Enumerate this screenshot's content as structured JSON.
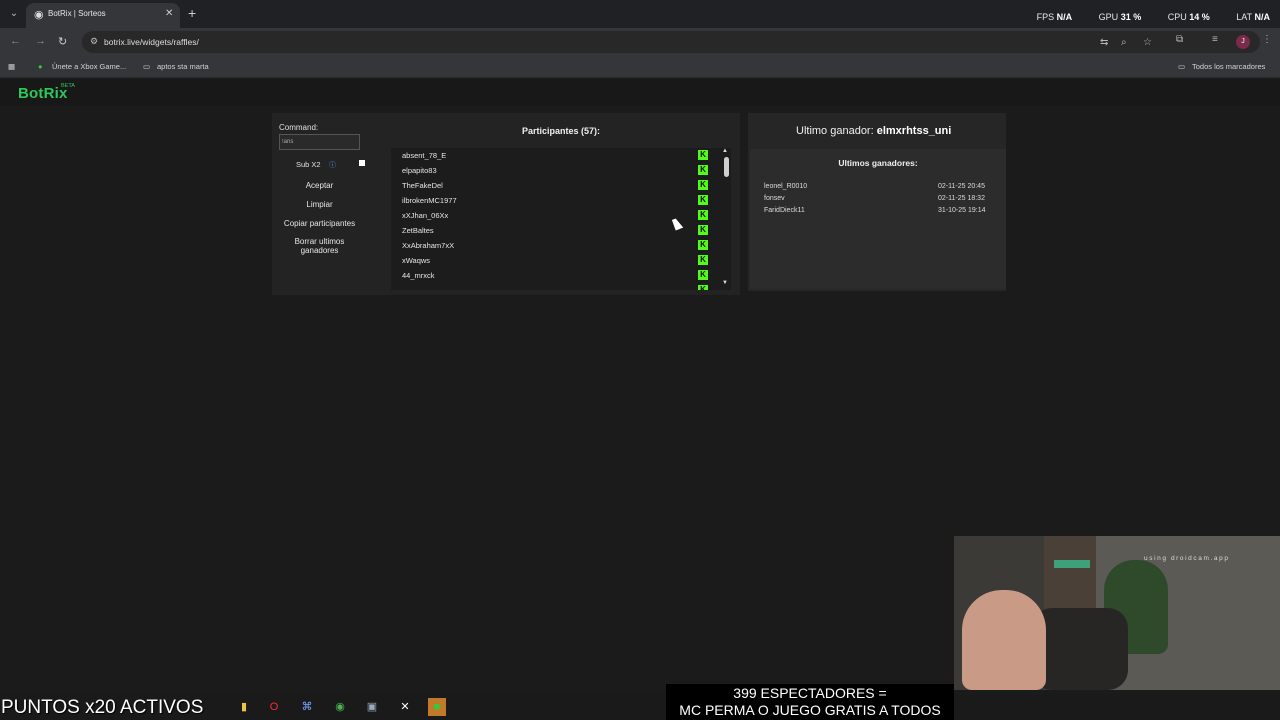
{
  "browser": {
    "tab_title": "BotRix | Sorteos",
    "url": "botrix.live/widgets/raffles/",
    "stats": {
      "fps_label": "FPS",
      "fps_value": "N/A",
      "gpu_label": "GPU",
      "gpu_value": "31 %",
      "cpu_label": "CPU",
      "cpu_value": "14 %",
      "lat_label": "LAT",
      "lat_value": "N/A"
    },
    "bookmarks": [
      "Únete a Xbox Game...",
      "aptos sta marta"
    ],
    "all_bookmarks": "Todos los marcadores",
    "profile_initial": "J"
  },
  "app": {
    "logo": "BotRix",
    "logo_badge": "BETA"
  },
  "raffle": {
    "command_label": "Command:",
    "command_value": "!aris",
    "sub_label": "Sub X2",
    "buttons": {
      "accept": "Aceptar",
      "clear": "Limpiar",
      "copy": "Copiar participantes",
      "delete_winners": "Borrar ultimos ganadores"
    },
    "participants_title": "Participantes (57):",
    "participants": [
      "absent_78_E",
      "elpapito83",
      "TheFakeDel",
      "ilbrokenMC1977",
      "xXJhan_06Xx",
      "ZetBaltes",
      "XxAbraham7xX",
      "xWaqws",
      "44_mrxck"
    ]
  },
  "winners": {
    "last_label": "Ultimo ganador: ",
    "last_name": "elmxrhtss_uni",
    "title": "Ultimos ganadores:",
    "list": [
      {
        "name": "leonel_R0010",
        "date": "02-11-25 20:45"
      },
      {
        "name": "fonsev",
        "date": "02-11-25 18:32"
      },
      {
        "name": "FaridDieck11",
        "date": "31-10-25 19:14"
      }
    ]
  },
  "webcam": {
    "watermark": "using droidcam.app"
  },
  "overlays": {
    "puntos": "PUNTOS x20 ACTIVOS",
    "espectadores_line1": "399 ESPECTADORES =",
    "espectadores_line2": "MC PERMA O JUEGO GRATIS A TODOS"
  },
  "colors": {
    "accent": "#2ec85a",
    "kick_green": "#53fc18"
  }
}
